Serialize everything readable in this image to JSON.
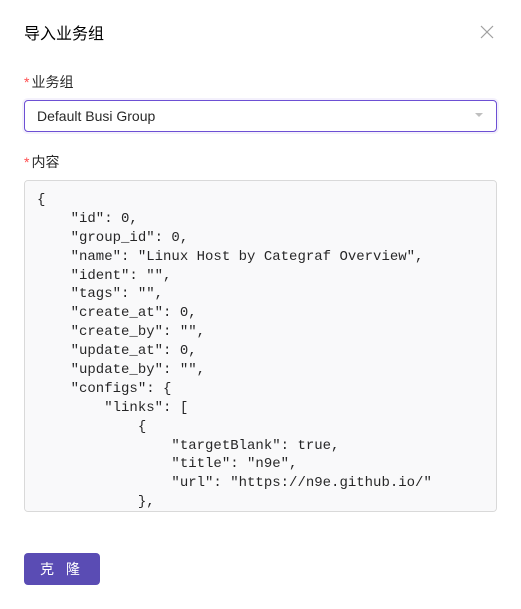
{
  "modal": {
    "title": "导入业务组"
  },
  "form": {
    "business_group": {
      "label": "业务组",
      "value": "Default Busi Group"
    },
    "content": {
      "label": "内容",
      "value": "{\n    \"id\": 0,\n    \"group_id\": 0,\n    \"name\": \"Linux Host by Categraf Overview\",\n    \"ident\": \"\",\n    \"tags\": \"\",\n    \"create_at\": 0,\n    \"create_by\": \"\",\n    \"update_at\": 0,\n    \"update_by\": \"\",\n    \"configs\": {\n        \"links\": [\n            {\n                \"targetBlank\": true,\n                \"title\": \"n9e\",\n                \"url\": \"https://n9e.github.io/\"\n            },"
    }
  },
  "actions": {
    "clone_label": "克 隆"
  }
}
